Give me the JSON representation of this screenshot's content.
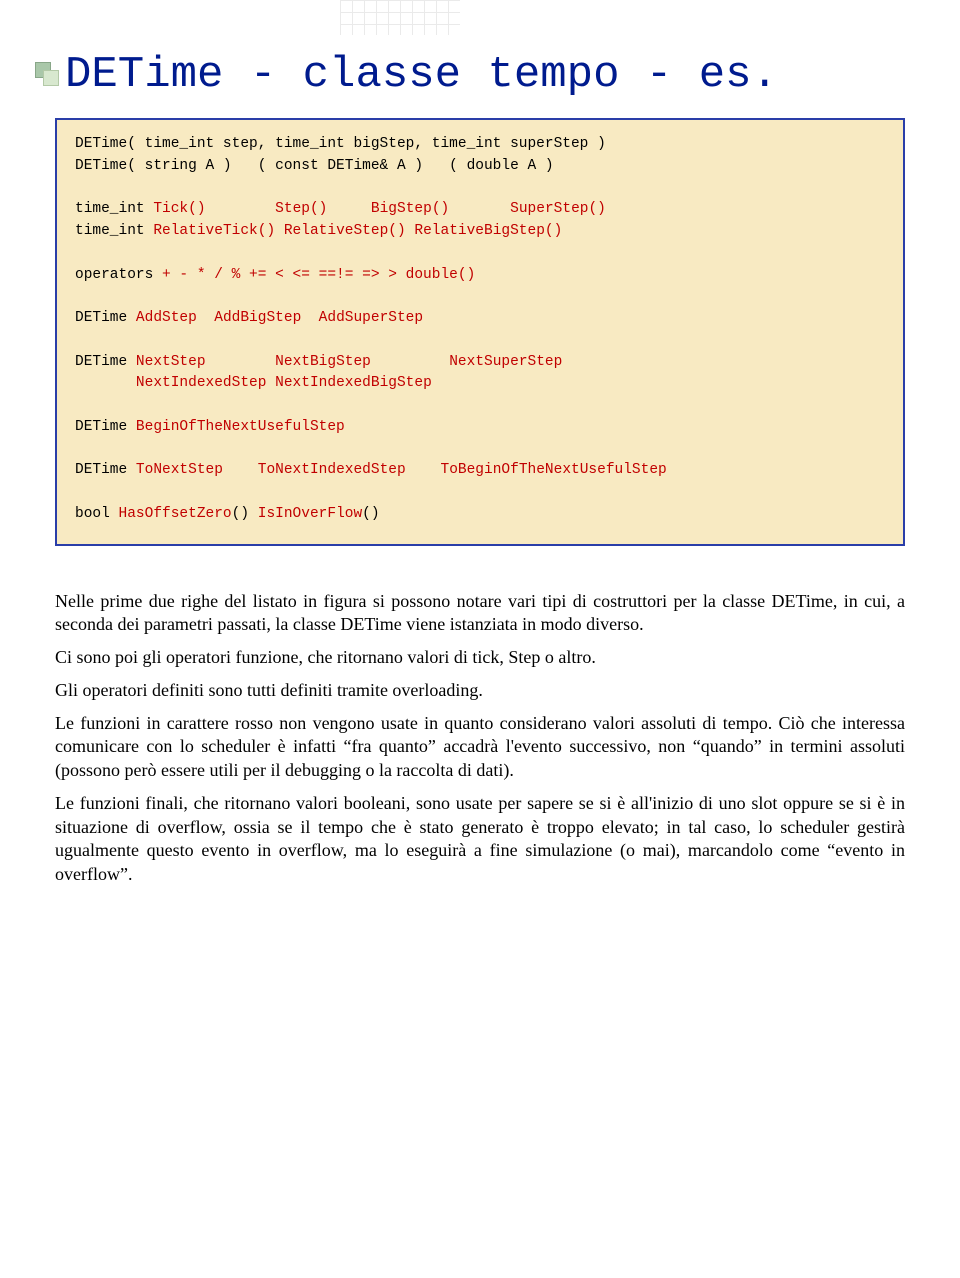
{
  "title": "DETime - classe tempo - es.",
  "code": {
    "line1": "DETime( time_int step, time_int bigStep, time_int superStep )",
    "line2": "DETime( string A )   ( const DETime& A )   ( double A )",
    "line3": "",
    "l4a": "time_int ",
    "l4b": "Tick()",
    "l4c": "        ",
    "l4d": "Step()",
    "l4e": "     ",
    "l4f": "BigStep()",
    "l4g": "       ",
    "l4h": "SuperStep()",
    "l5a": "time_int ",
    "l5b": "RelativeTick()",
    "l5c": " ",
    "l5d": "RelativeStep()",
    "l5e": " ",
    "l5f": "RelativeBigStep()",
    "line6": "",
    "l7a": "operators ",
    "l7b": "+ - * / % += < <= ==!= => > double()",
    "line8": "",
    "l9a": "DETime ",
    "l9b": "AddStep",
    "l9c": "  ",
    "l9d": "AddBigStep",
    "l9e": "  ",
    "l9f": "AddSuperStep",
    "line10": "",
    "l11a": "DETime ",
    "l11b": "NextStep",
    "l11c": "        ",
    "l11d": "NextBigStep",
    "l11e": "         ",
    "l11f": "NextSuperStep",
    "l12a": "       ",
    "l12b": "NextIndexedStep",
    "l12c": " ",
    "l12d": "NextIndexedBigStep",
    "line13": "",
    "l14a": "DETime ",
    "l14b": "BeginOfTheNextUsefulStep",
    "line15": "",
    "l16a": "DETime ",
    "l16b": "ToNextStep",
    "l16c": "    ",
    "l16d": "ToNextIndexedStep",
    "l16e": "    ",
    "l16f": "ToBeginOfTheNextUsefulStep",
    "line17": "",
    "l18a": "bool ",
    "l18b": "HasOffsetZero",
    "l18c": "() ",
    "l18d": "IsInOverFlow",
    "l18e": "()"
  },
  "paragraphs": {
    "p1": "Nelle prime due righe del listato in figura si possono notare vari tipi di costruttori per la classe DETime, in cui, a seconda dei parametri passati, la classe DETime viene istanziata in modo diverso.",
    "p2": "Ci sono poi gli operatori funzione, che ritornano valori di tick, Step o altro.",
    "p3": "Gli operatori definiti sono tutti definiti tramite overloading.",
    "p4": "Le funzioni in carattere rosso non vengono usate in quanto considerano valori assoluti di tempo. Ciò che interessa comunicare con lo scheduler è infatti “fra quanto” accadrà l'evento successivo, non “quando” in termini assoluti (possono però essere utili per il debugging o la raccolta di dati).",
    "p5": "Le funzioni finali, che ritornano valori booleani, sono usate per sapere se si è all'inizio di uno slot oppure se si è in situazione di overflow, ossia se il tempo che è stato generato è troppo elevato; in tal caso, lo scheduler gestirà ugualmente questo evento in overflow, ma lo eseguirà a fine simulazione (o mai), marcandolo come “evento in overflow”."
  }
}
